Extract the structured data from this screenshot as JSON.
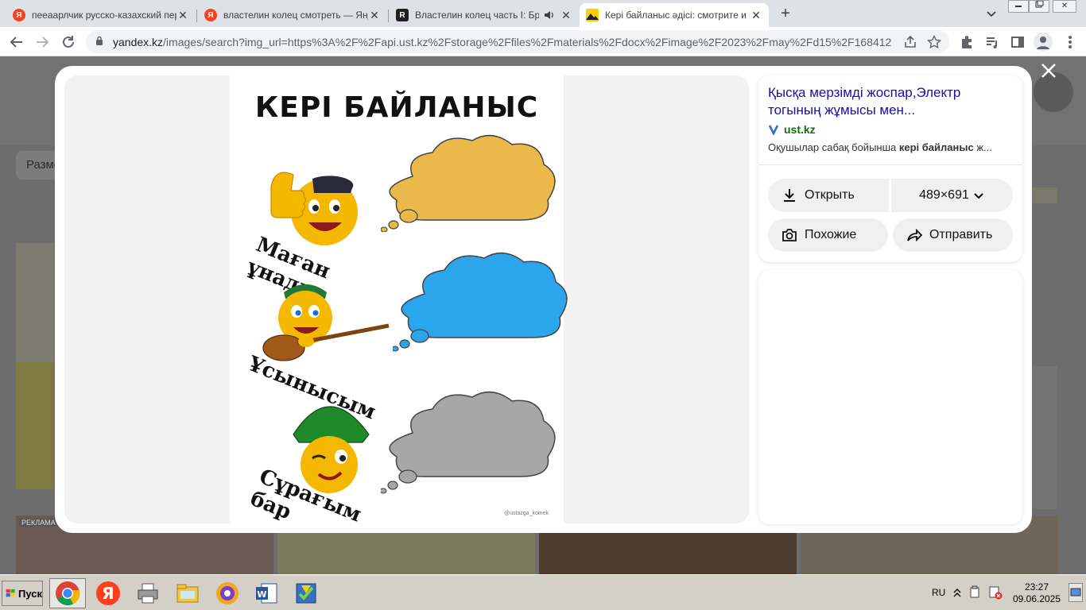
{
  "browser": {
    "tabs": [
      {
        "title": "пееаарлчик русско-казахский пер",
        "favicon": "yandex-icon"
      },
      {
        "title": "властелин колец смотреть — Янде",
        "favicon": "yandex-icon"
      },
      {
        "title": "Властелин колец часть I: Бра",
        "favicon": "r-icon",
        "audio": true
      },
      {
        "title": "Кері байланыс әдісі: смотрите и с",
        "favicon": "yandex-images-icon",
        "active": true
      }
    ],
    "close_glyph": "✕",
    "new_tab_glyph": "+",
    "url_domain": "yandex.kz",
    "url_rest": "/images/search?img_url=https%3A%2F%2Fapi.ust.kz%2Fstorage%2Ffiles%2Fmaterials%2Fdocx%2Fimage%2F2023%2Fmay%2Fd15%2F168412..."
  },
  "viewer": {
    "image": {
      "heading": "КЕРІ БАЙЛАНЫС",
      "label_1": "Маған ұнады",
      "label_2": "Ұсынысым",
      "label_3": "Сұрағым бар",
      "watermark": "@ustazga_komek"
    },
    "title": "Қысқа мерзімді жоспар,Электр тогының жұмысы мен...",
    "source": "ust.kz",
    "snippet_prefix": "Оқушылар сабақ бойынша ",
    "snippet_bold": "кері байланыс",
    "snippet_suffix": " ж...",
    "buttons": {
      "open": "Открыть",
      "size": "489×691",
      "similar": "Похожие",
      "share": "Отправить"
    }
  },
  "page_behind": {
    "filter_label": "Разме",
    "ad_label": "РЕКЛАМА"
  },
  "taskbar": {
    "start": "Пуск",
    "lang": "RU",
    "time": "23:27",
    "date": "09.06.2025"
  },
  "colors": {
    "cloud_orange": "#ebb84a",
    "cloud_blue": "#2ba6ec",
    "cloud_gray": "#a7a7a7",
    "link_blue": "#1a0dab",
    "source_green": "#0f6f0f"
  }
}
